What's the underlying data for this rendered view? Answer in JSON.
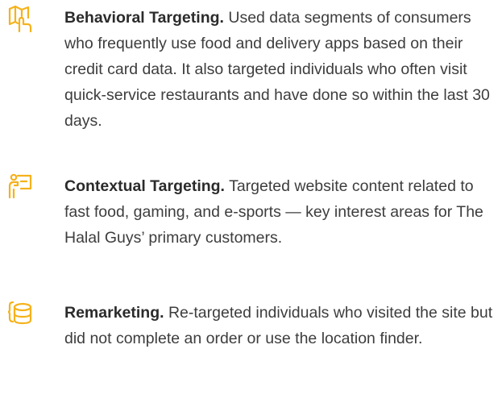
{
  "accent_color": "#F5B21B",
  "items": [
    {
      "icon": "map-icon",
      "title": "Behavioral Targeting.",
      "body": "Used data segments of consumers who frequently use food and delivery apps based on their credit card data. It also targeted individuals who often visit quick-service restaurants and have done so within the last 30 days."
    },
    {
      "icon": "presenter-icon",
      "title": "Contextual Targeting.",
      "body": "Targeted website content related to fast food, gaming, and e-sports — key interest areas for The Halal Guys’ primary customers."
    },
    {
      "icon": "database-icon",
      "title": "Remarketing.",
      "body": "Re-targeted individuals who visited the site but did not complete an order or use the location finder."
    }
  ]
}
